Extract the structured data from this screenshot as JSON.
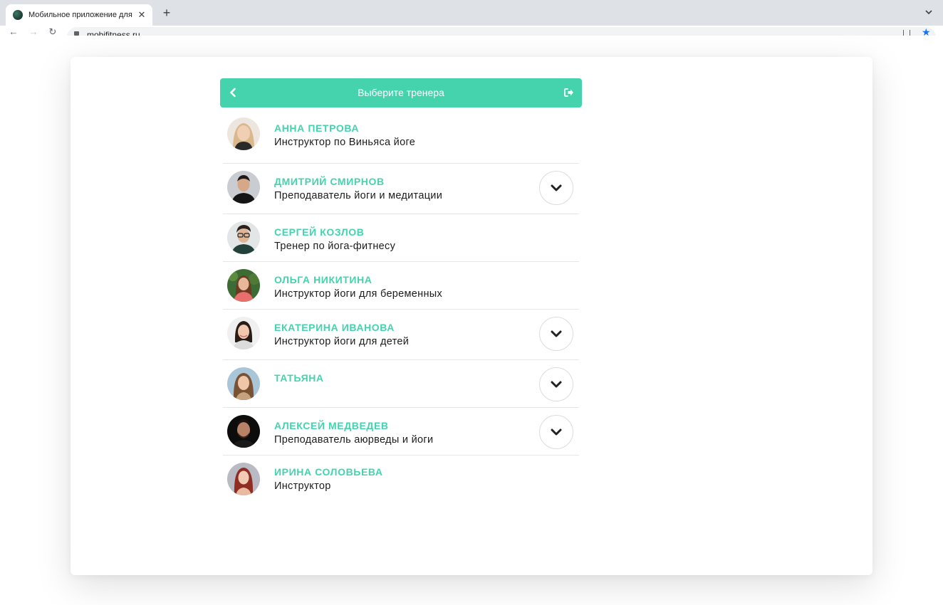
{
  "browser": {
    "tab_title": "Мобильное приложение для",
    "tab_close": "✕",
    "new_tab": "+",
    "url": "mobifitness.ru",
    "nav_back": "←",
    "nav_forward": "→",
    "nav_reload": "↻",
    "bookmark_star": "★"
  },
  "app": {
    "header_title": "Выберите тренера",
    "accent_color": "#45d3ae"
  },
  "trainers": [
    {
      "name": "АННА ПЕТРОВА",
      "role": "Инструктор по Виньяса йоге",
      "expandable": false
    },
    {
      "name": "ДМИТРИЙ СМИРНОВ",
      "role": "Преподаватель йоги и медитации",
      "expandable": true
    },
    {
      "name": "СЕРГЕЙ КОЗЛОВ",
      "role": "Тренер по йога-фитнесу",
      "expandable": false
    },
    {
      "name": "ОЛЬГА НИКИТИНА",
      "role": "Инструктор йоги для беременных",
      "expandable": false
    },
    {
      "name": "ЕКАТЕРИНА ИВАНОВА",
      "role": "Инструктор йоги для детей",
      "expandable": true
    },
    {
      "name": "ТАТЬЯНА",
      "role": "",
      "expandable": true
    },
    {
      "name": "АЛЕКСЕЙ МЕДВЕДЕВ",
      "role": "Преподаватель аюрведы и йоги",
      "expandable": true
    },
    {
      "name": "ИРИНА СОЛОВЬЕВА",
      "role": "Инструктор",
      "expandable": false
    }
  ]
}
